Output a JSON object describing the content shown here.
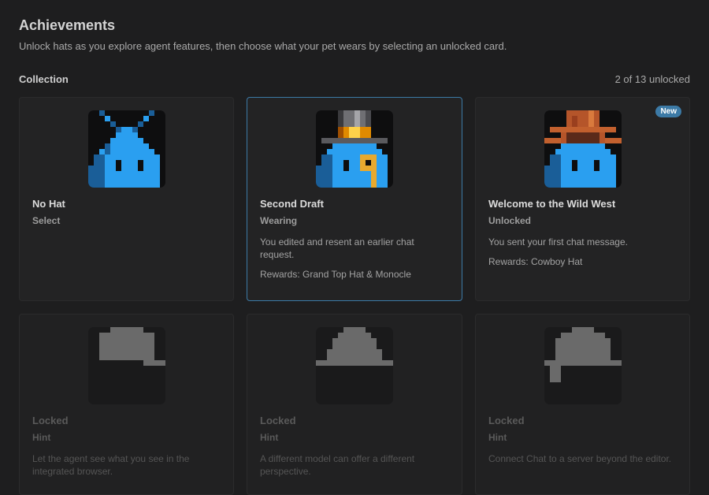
{
  "header": {
    "title": "Achievements",
    "subtitle": "Unlock hats as you explore agent features, then choose what your pet wears by selecting an unlocked card."
  },
  "collection": {
    "title": "Collection",
    "count": "2 of 13 unlocked"
  },
  "cards": [
    {
      "name": "No Hat",
      "status": "Select",
      "description": "",
      "rewards": "",
      "hat": "none",
      "selected": false,
      "locked": false
    },
    {
      "name": "Second Draft",
      "status": "Wearing",
      "description": "You edited and resent an earlier chat request.",
      "rewards": "Rewards: Grand Top Hat & Monocle",
      "hat": "top-hat-monocle",
      "selected": true,
      "locked": false
    },
    {
      "name": "Welcome to the Wild West",
      "status": "Unlocked",
      "badge": "New",
      "description": "You sent your first chat message.",
      "rewards": "Rewards: Cowboy Hat",
      "hat": "cowboy-hat",
      "selected": false,
      "locked": false
    },
    {
      "name": "Locked",
      "status": "Hint",
      "description": "Let the agent see what you see in the integrated browser.",
      "hat": "locked-silhouette",
      "locked": true
    },
    {
      "name": "Locked",
      "status": "Hint",
      "description": "A different model can offer a different perspective.",
      "hat": "locked-silhouette",
      "locked": true
    },
    {
      "name": "Locked",
      "status": "Hint",
      "description": "Connect Chat to a server beyond the editor.",
      "hat": "locked-silhouette",
      "locked": true
    }
  ],
  "colors": {
    "accent": "#3c7aa6",
    "pet_blue": "#2a9ff0",
    "pet_dark": "#1a5e98",
    "locked_gray": "#6a6a6a"
  }
}
